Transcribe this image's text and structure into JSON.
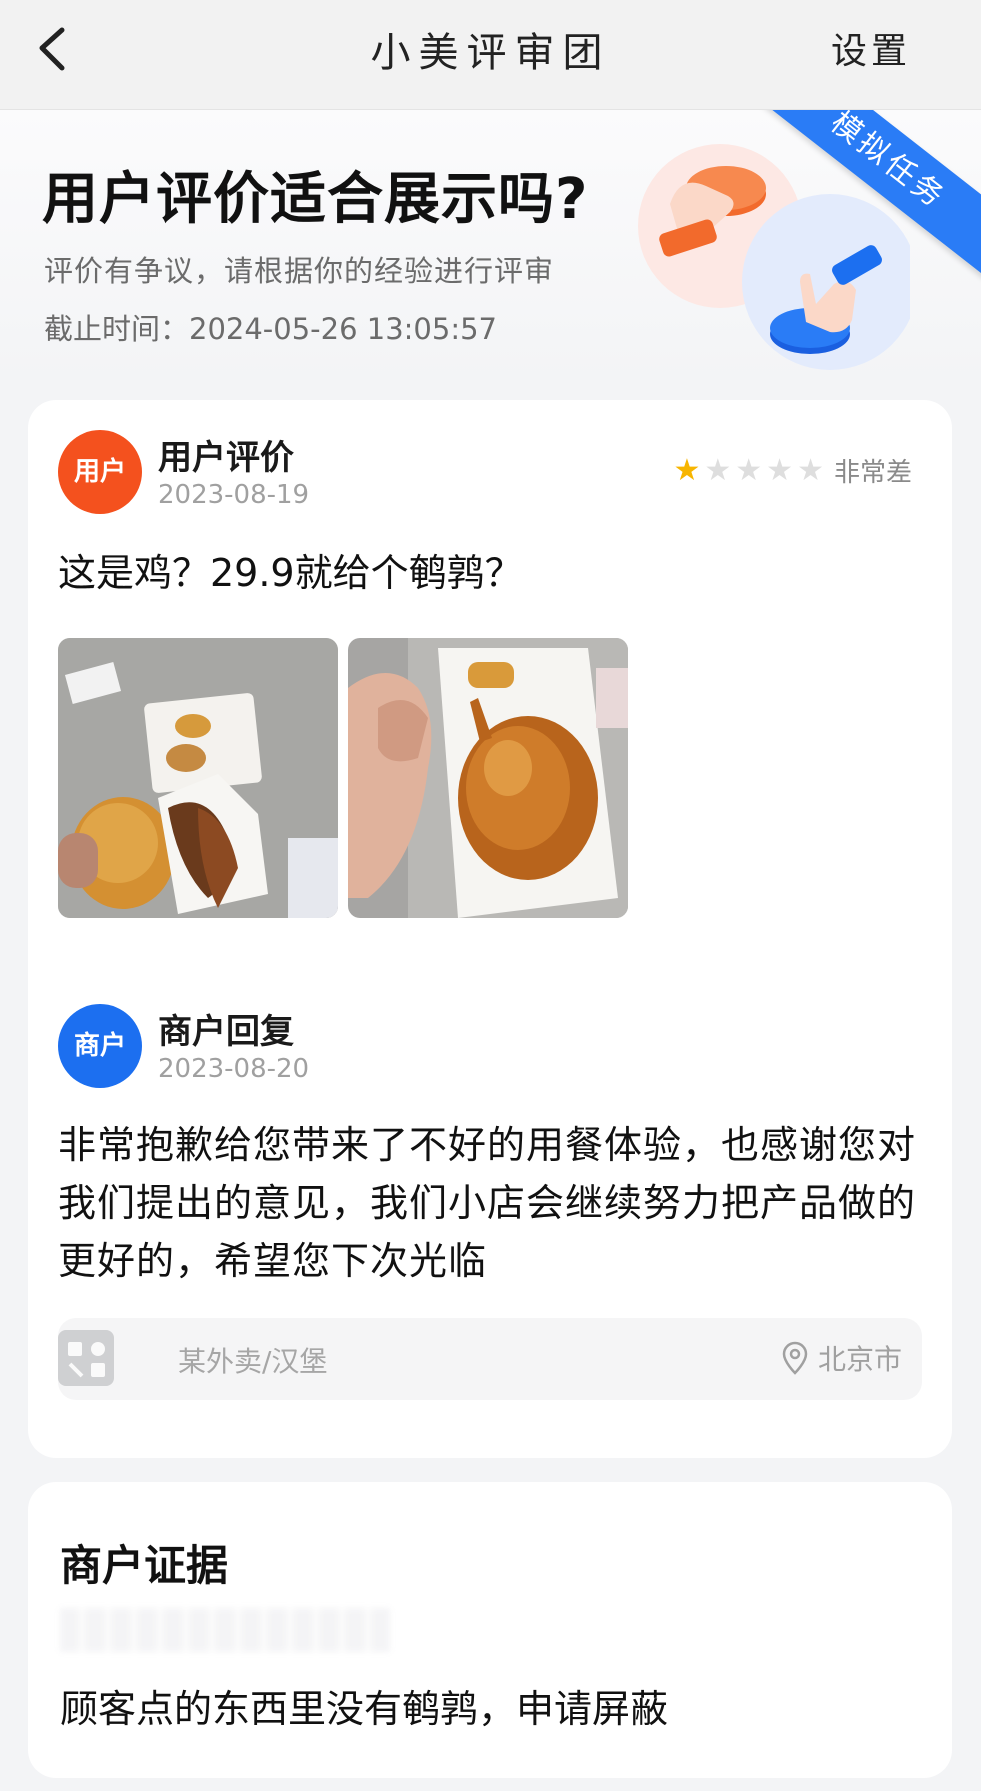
{
  "nav": {
    "title": "小美评审团",
    "settings_label": "设置"
  },
  "banner": {
    "title": "用户评价适合展示吗?",
    "subtitle": "评价有争议，请根据你的经验进行评审",
    "deadline": "截止时间：2024-05-26 13:05:57",
    "ribbon_label": "模拟任务"
  },
  "review": {
    "avatar_label": "用户",
    "author": "用户评价",
    "date": "2023-08-19",
    "rating": 1,
    "rating_max": 5,
    "rating_text": "非常差",
    "text": "这是鸡？29.9就给个鹌鹑？",
    "photos": [
      "photo-burger-and-fries",
      "photo-roast-bird"
    ]
  },
  "reply": {
    "avatar_label": "商户",
    "author": "商户回复",
    "date": "2023-08-20",
    "text": "非常抱歉给您带来了不好的用餐体验，也感谢您对我们提出的意见，我们小店会继续努力把产品做的更好的，希望您下次光临"
  },
  "shop": {
    "name": "某外卖/汉堡",
    "location": "北京市"
  },
  "evidence": {
    "title": "商户证据",
    "text": "顾客点的东西里没有鹌鹑，申请屏蔽"
  },
  "colors": {
    "user_avatar": "#f4511e",
    "merchant_avatar": "#1c6ff0",
    "ribbon": "#2a7cf6",
    "star_on": "#f7b500"
  }
}
